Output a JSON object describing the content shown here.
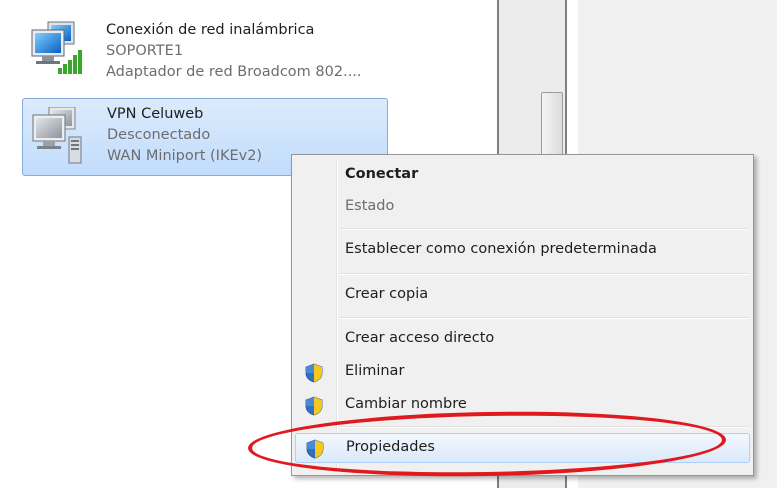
{
  "connections": [
    {
      "name": "Conexión de red inalámbrica",
      "status": "SOPORTE1",
      "device": "Adaptador de red Broadcom 802....",
      "icon": "wireless-network-icon",
      "selected": false
    },
    {
      "name": "VPN Celuweb",
      "status": "Desconectado",
      "device": "WAN Miniport (IKEv2)",
      "icon": "vpn-connection-icon",
      "selected": true
    }
  ],
  "context_menu": {
    "items": [
      {
        "label": "Conectar",
        "style": "bold",
        "shield": false
      },
      {
        "label": "Estado",
        "style": "disabled",
        "shield": false
      },
      {
        "label": "Establecer como conexión predeterminada",
        "style": "normal",
        "shield": false
      },
      {
        "label": "Crear copia",
        "style": "normal",
        "shield": false
      },
      {
        "label": "Crear acceso directo",
        "style": "normal",
        "shield": false
      },
      {
        "label": "Eliminar",
        "style": "normal",
        "shield": true
      },
      {
        "label": "Cambiar nombre",
        "style": "normal",
        "shield": true
      },
      {
        "label": "Propiedades",
        "style": "highlighted",
        "shield": true
      }
    ]
  },
  "annotation": {
    "color": "#e0191e",
    "target": "Propiedades"
  },
  "colors": {
    "selection": "#c1dcfc",
    "menu_background": "#f0f0f0",
    "shield_blue": "#2f6fc4",
    "shield_yellow": "#f4c81c"
  }
}
